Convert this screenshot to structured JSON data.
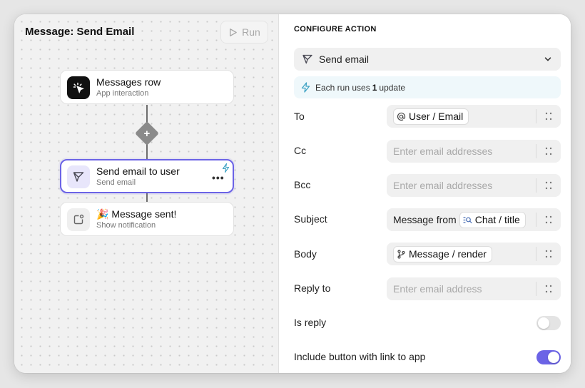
{
  "canvas": {
    "title": "Message: Send Email",
    "run_label": "Run",
    "add_symbol": "+",
    "nodes": [
      {
        "title": "Messages row",
        "subtitle": "App interaction",
        "icon": "cursor-click-icon"
      },
      {
        "title": "Send email to user",
        "subtitle": "Send email",
        "icon": "send-icon",
        "menu": "•••",
        "selected": true
      },
      {
        "title": "🎉 Message sent!",
        "subtitle": "Show notification",
        "icon": "notification-icon"
      }
    ]
  },
  "panel": {
    "section_title": "CONFIGURE ACTION",
    "action": {
      "label": "Send email",
      "icon": "send-icon"
    },
    "info": {
      "prefix": "Each run uses",
      "count": "1",
      "suffix": "update",
      "icon": "bolt-icon"
    },
    "fields": [
      {
        "label": "To",
        "pill": "User / Email",
        "pill_icon": "at-icon"
      },
      {
        "label": "Cc",
        "placeholder": "Enter email addresses"
      },
      {
        "label": "Bcc",
        "placeholder": "Enter email addresses"
      },
      {
        "label": "Subject",
        "text": "Message from",
        "pill": "Chat / title",
        "pill_icon": "search-list-icon"
      },
      {
        "label": "Body",
        "pill": "Message / render",
        "pill_icon": "branch-icon"
      },
      {
        "label": "Reply to",
        "placeholder": "Enter email address"
      }
    ],
    "toggles": [
      {
        "label": "Is reply",
        "on": false
      },
      {
        "label": "Include button with link to app",
        "on": true
      }
    ]
  },
  "colors": {
    "accent": "#6b63e6",
    "info_bg": "#eff8fb",
    "bolt": "#3fa3c4"
  }
}
